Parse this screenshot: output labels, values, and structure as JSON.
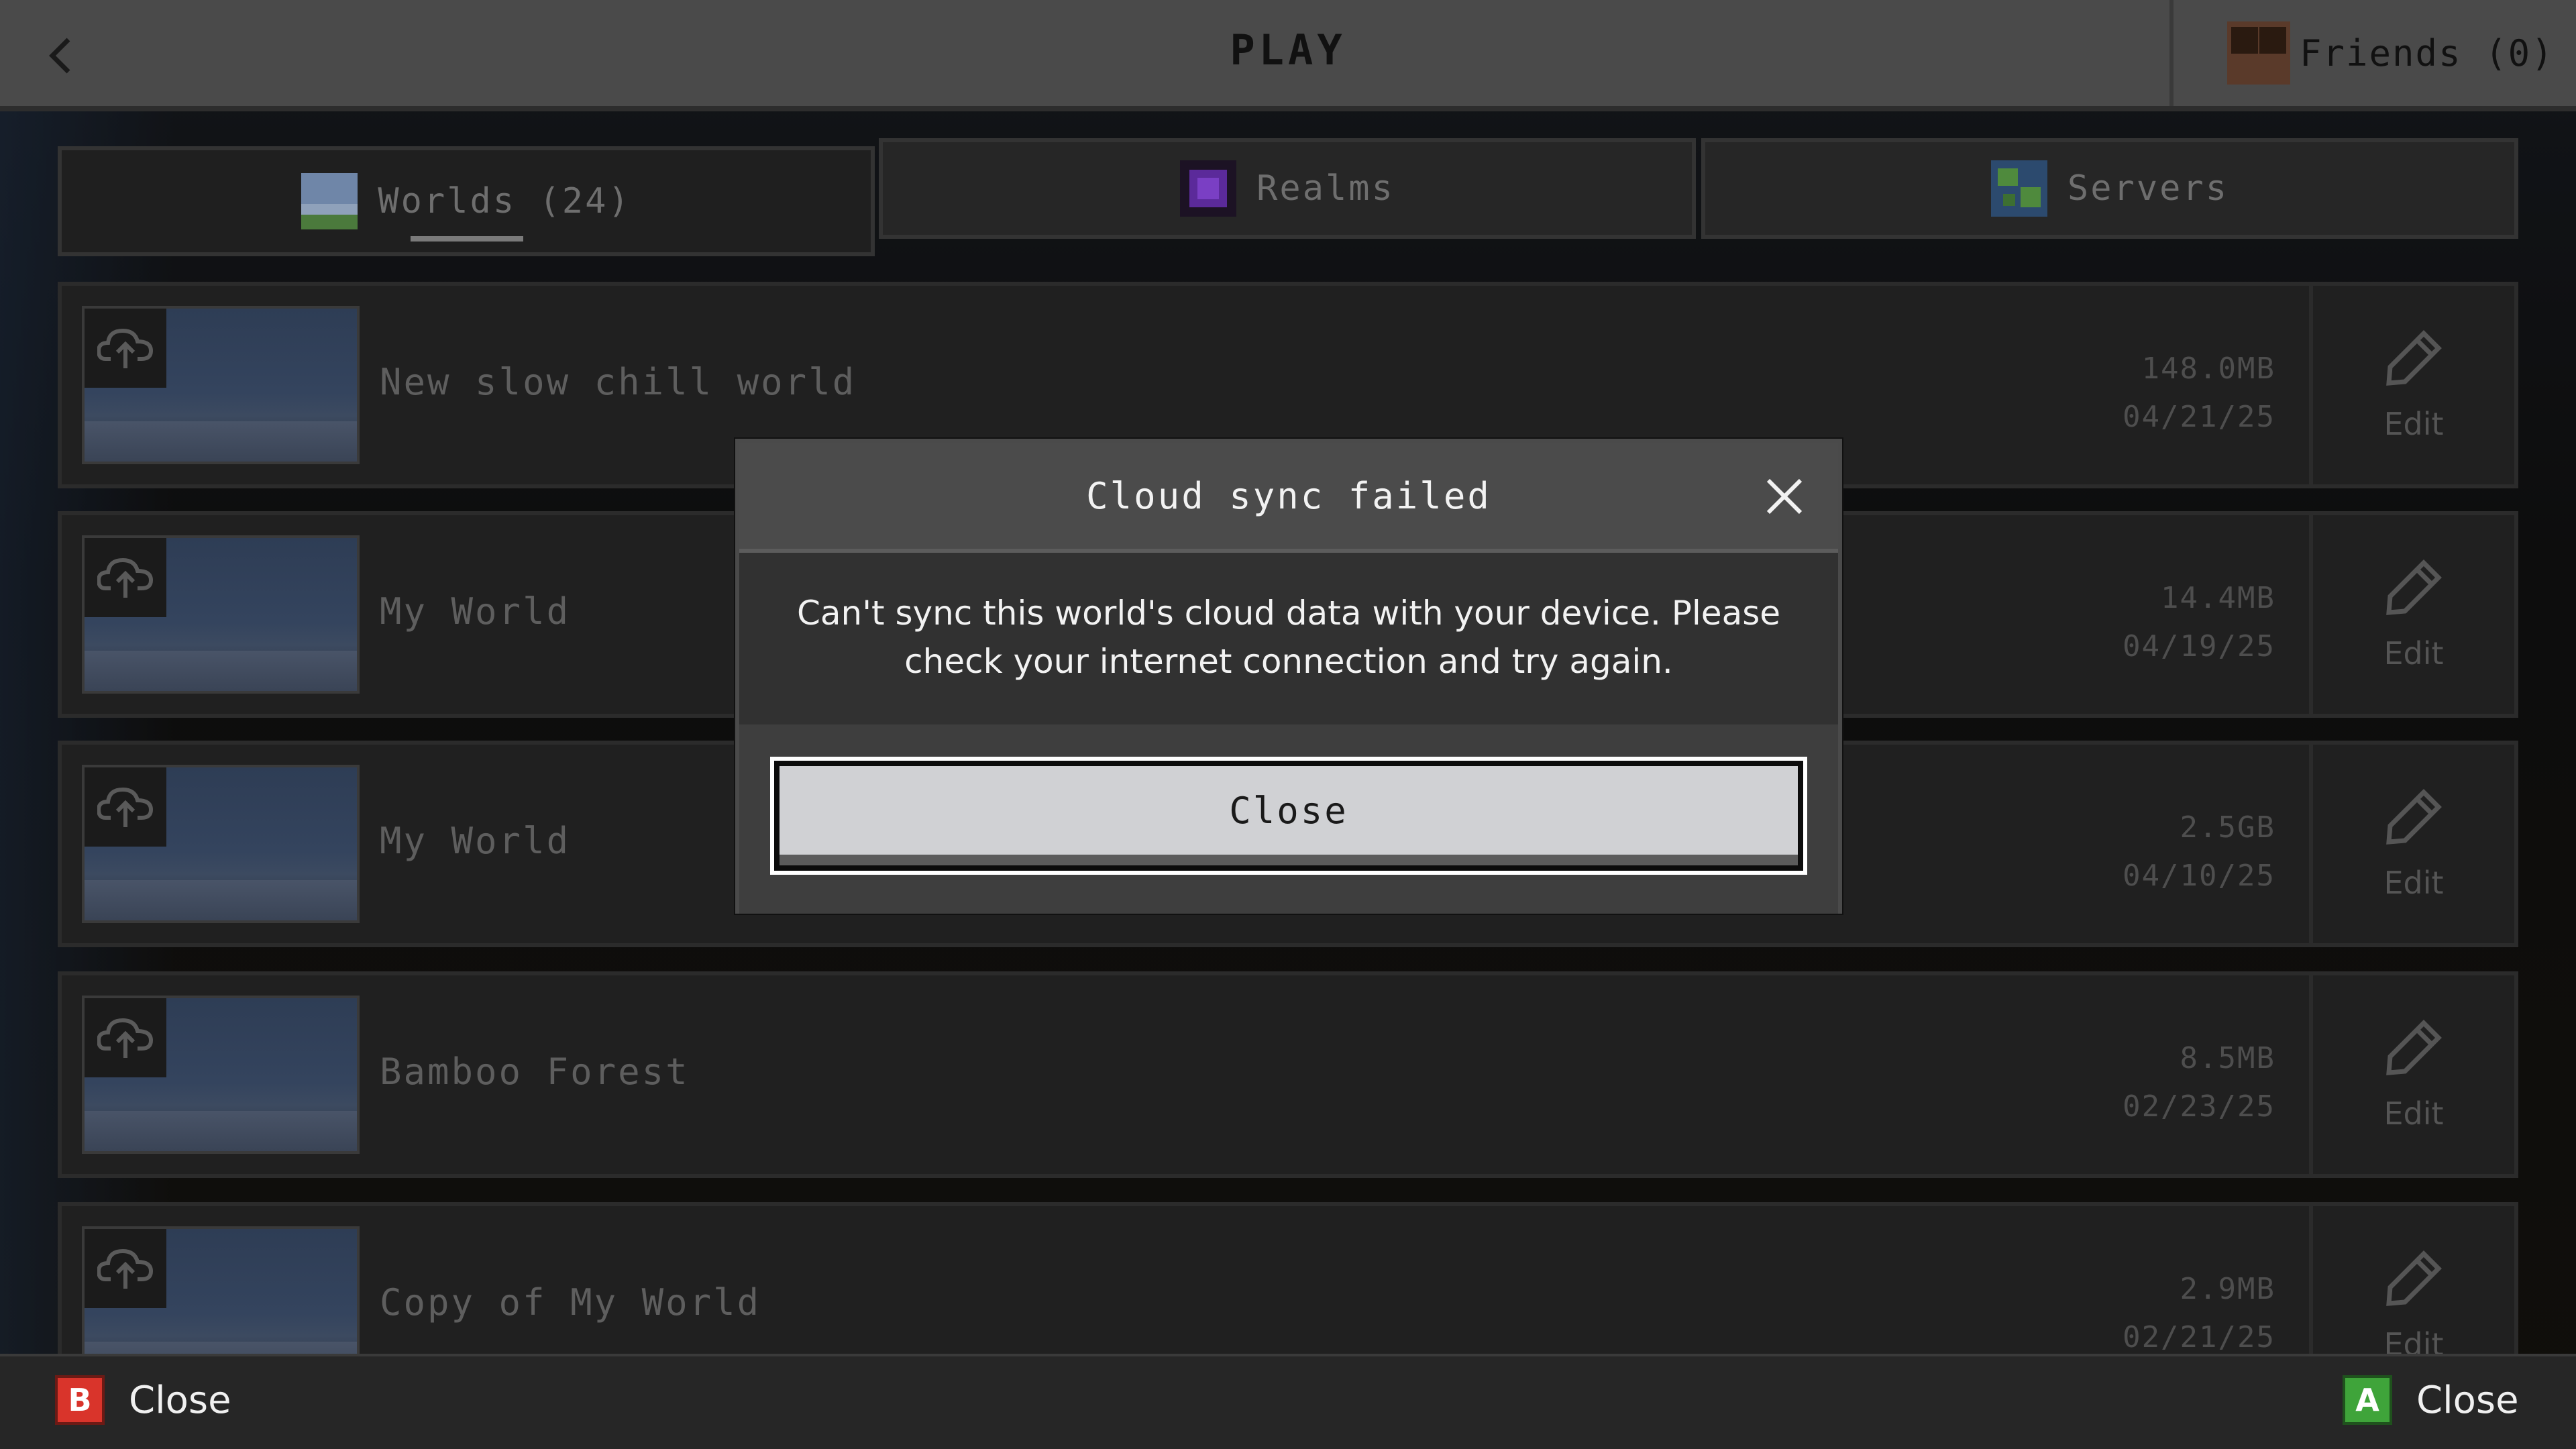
{
  "header": {
    "title": "PLAY",
    "friends_label": "Friends (0)"
  },
  "tabs": [
    {
      "label": "Worlds (24)",
      "icon": "grass-landscape-icon",
      "active": true
    },
    {
      "label": "Realms",
      "icon": "realms-portal-icon",
      "active": false
    },
    {
      "label": "Servers",
      "icon": "globe-icon",
      "active": false
    }
  ],
  "worlds": [
    {
      "name": "New slow chill world",
      "size": "148.0MB",
      "date": "04/21/25",
      "edit_label": "Edit"
    },
    {
      "name": "My World",
      "size": "14.4MB",
      "date": "04/19/25",
      "edit_label": "Edit"
    },
    {
      "name": "My World",
      "size": "2.5GB",
      "date": "04/10/25",
      "edit_label": "Edit"
    },
    {
      "name": "Bamboo Forest",
      "size": "8.5MB",
      "date": "02/23/25",
      "edit_label": "Edit"
    },
    {
      "name": "Copy of My World",
      "size": "2.9MB",
      "date": "02/21/25",
      "edit_label": "Edit"
    }
  ],
  "dialog": {
    "title": "Cloud sync failed",
    "message_line1": "Can't sync this world's cloud data with your device. Please",
    "message_line2": "check your internet connection and try again.",
    "button_label": "Close"
  },
  "footer": {
    "left_key": "B",
    "left_label": "Close",
    "right_key": "A",
    "right_label": "Close"
  },
  "colors": {
    "b_button": "#d9342b",
    "a_button": "#3fa43a",
    "realms_purple": "#5b2a9a"
  }
}
